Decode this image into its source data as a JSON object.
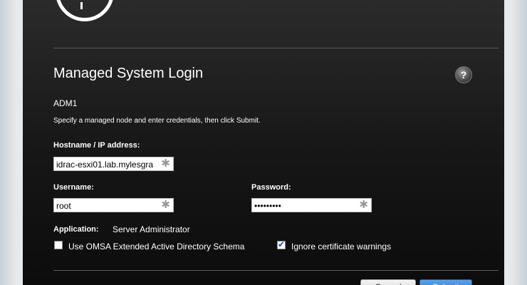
{
  "dialog": {
    "title": "Managed System Login",
    "help_symbol": "?",
    "system_name": "ADM1",
    "instructions": "Specify a managed node and enter credentials, then click Submit."
  },
  "form": {
    "hostname_label": "Hostname / IP address:",
    "hostname_value": "idrac-esxi01.lab.mylesgra",
    "username_label": "Username:",
    "username_value": "root",
    "password_label": "Password:",
    "password_value": "•••••••••",
    "required_symbol": "✱"
  },
  "application": {
    "label": "Application:",
    "value": "Server Administrator"
  },
  "options": {
    "omsa_schema_label": "Use OMSA Extended Active Directory Schema",
    "omsa_schema_checked": false,
    "ignore_cert_label": "Ignore certificate warnings",
    "ignore_cert_checked": true
  },
  "buttons": {
    "cancel_label": "Cancel",
    "submit_label": "Submit"
  }
}
